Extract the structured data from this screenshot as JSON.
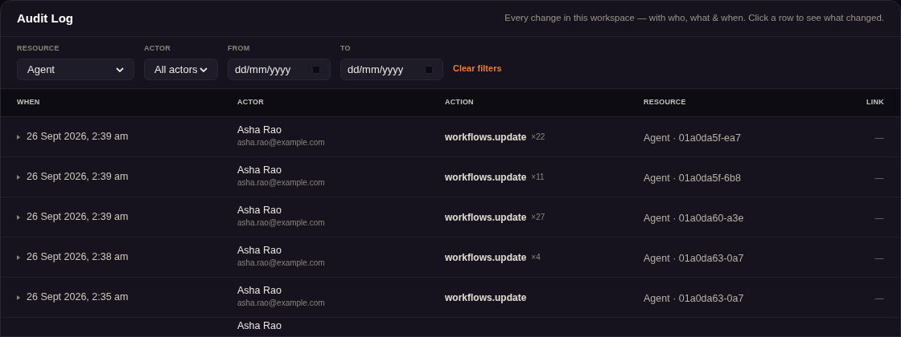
{
  "header": {
    "title": "Audit Log",
    "subtitle": "Every change in this workspace — with who, what & when. Click a row to see what changed."
  },
  "filters": [
    {
      "kind": "select",
      "label": "RESOURCE",
      "value": "Agent"
    },
    {
      "kind": "select",
      "label": "ACTOR",
      "value": "All actors"
    },
    {
      "kind": "date",
      "label": "FROM",
      "placeholder": "dd/mm/yyyy"
    },
    {
      "kind": "date",
      "label": "TO",
      "placeholder": "dd/mm/yyyy"
    }
  ],
  "clear_filters": "Clear filters",
  "table": {
    "columns": [
      "WHEN",
      "ACTOR",
      "ACTION",
      "RESOURCE",
      "LINK"
    ],
    "rows": [
      {
        "when": "26 Sept 2026, 2:39 am",
        "actor": "Asha Rao",
        "email": "asha.rao@example.com",
        "action": "workflows.update",
        "count": "×22",
        "resource": "Agent · 01a0da5f-ea7",
        "link": "—"
      },
      {
        "when": "26 Sept 2026, 2:39 am",
        "actor": "Asha Rao",
        "email": "asha.rao@example.com",
        "action": "workflows.update",
        "count": "×11",
        "resource": "Agent · 01a0da5f-6b8",
        "link": "—"
      },
      {
        "when": "26 Sept 2026, 2:39 am",
        "actor": "Asha Rao",
        "email": "asha.rao@example.com",
        "action": "workflows.update",
        "count": "×27",
        "resource": "Agent · 01a0da60-a3e",
        "link": "—"
      },
      {
        "when": "26 Sept 2026, 2:38 am",
        "actor": "Asha Rao",
        "email": "asha.rao@example.com",
        "action": "workflows.update",
        "count": "×4",
        "resource": "Agent · 01a0da63-0a7",
        "link": "—"
      },
      {
        "when": "26 Sept 2026, 2:35 am",
        "actor": "Asha Rao",
        "email": "asha.rao@example.com",
        "action": "workflows.update",
        "resource": "Agent · 01a0da63-0a7",
        "link": "—"
      },
      {
        "actor": "Asha Rao"
      }
    ]
  }
}
